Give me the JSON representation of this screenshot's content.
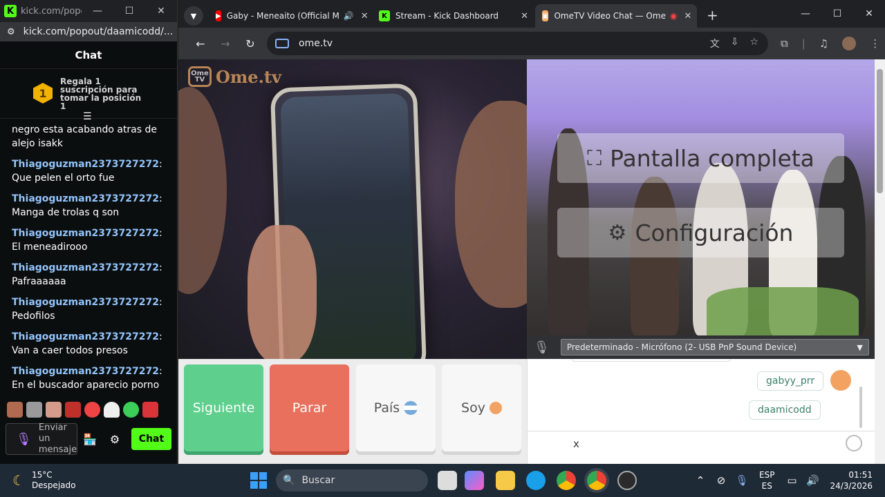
{
  "popup": {
    "title": "kick.com/popo...",
    "url": "kick.com/popout/daamicodd/...",
    "chat_title": "Chat",
    "pinned": "Regala 1 suscripción para tomar la posición 1",
    "pinned_rank": "1",
    "messages": [
      {
        "user": "",
        "text": "negro esta acabando atras de alejo isakk"
      },
      {
        "user": "Thiagoguzman2373727272",
        "text": ": Que pelen el orto fue"
      },
      {
        "user": "Thiagoguzman2373727272",
        "text": ": Manga de trolas q son"
      },
      {
        "user": "Thiagoguzman2373727272",
        "text": ": El meneadirooo"
      },
      {
        "user": "Thiagoguzman2373727272",
        "text": ": Pafraaaaaa"
      },
      {
        "user": "Thiagoguzman2373727272",
        "text": ": Pedofilos"
      },
      {
        "user": "Thiagoguzman2373727272",
        "text": ": Van a caer todos presos"
      },
      {
        "user": "Thiagoguzman2373727272",
        "text": ": En el buscador aparecio porno"
      }
    ],
    "input_placeholder": "Enviar un mensaje",
    "chat_button": "Chat"
  },
  "browser": {
    "tabs": [
      {
        "title": "Gaby - Meneaito (Official M",
        "icon": "youtube-icon"
      },
      {
        "title": "Stream - Kick Dashboard",
        "icon": "kick-icon"
      },
      {
        "title": "OmeTV Video Chat — Ome",
        "icon": "ometv-icon"
      }
    ],
    "url": "ome.tv"
  },
  "ometv": {
    "logo": "Ome.tv",
    "logo_badge": "Ome TV",
    "fullscreen": "Pantalla completa",
    "settings": "Configuración",
    "mic_device": "Predeterminado - Micrófono (2- USB PnP Sound Device)",
    "buttons": {
      "next": "Siguiente",
      "stop": "Parar",
      "country": "País",
      "me": "Soy"
    },
    "chat": {
      "bubble1": "gabyy_prr",
      "bubble2": "daamicodd",
      "input": "x"
    }
  },
  "taskbar": {
    "temp": "15°C",
    "weather": "Despejado",
    "search": "Buscar",
    "lang1": "ESP",
    "lang2": "ES",
    "time": "01:51",
    "date": "24/3/2026"
  },
  "colors": {
    "kick": "#53fc18",
    "user": "#93c5fd",
    "next": "#5ecf8c",
    "stop": "#e8705c"
  }
}
